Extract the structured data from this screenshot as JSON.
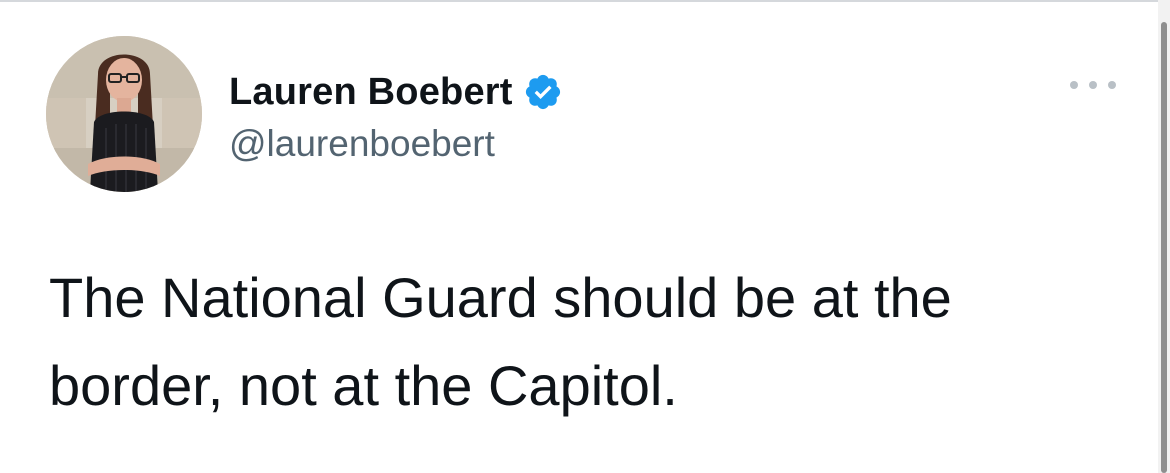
{
  "tweet": {
    "author": {
      "display_name": "Lauren Boebert",
      "handle": "@laurenboebert",
      "verified": true,
      "avatar_icon": "profile-photo"
    },
    "text": "The National Guard should be at the border, not at the Capitol.",
    "more_icon": "more-horizontal-icon"
  },
  "colors": {
    "text_primary": "#0f1419",
    "text_secondary": "#536471",
    "verified_blue": "#1d9bf0",
    "menu_dots": "#b9c0c6"
  }
}
